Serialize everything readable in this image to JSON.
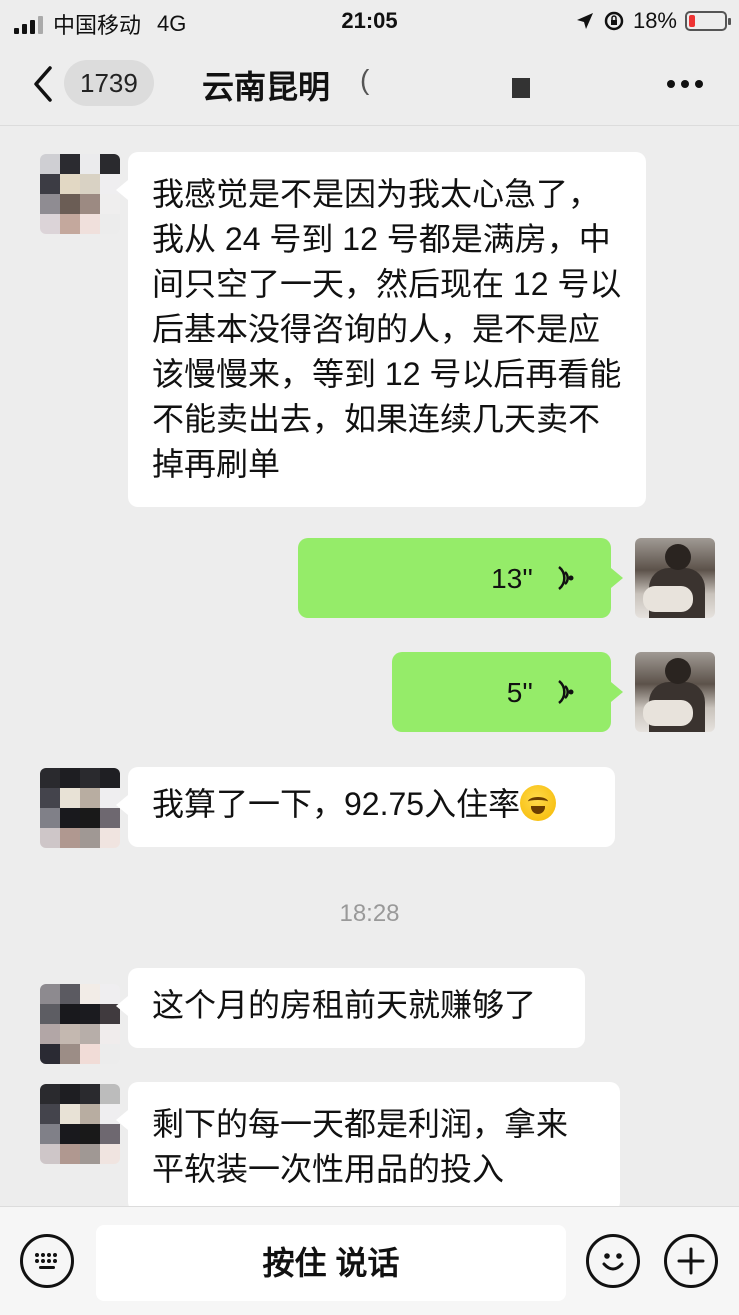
{
  "status_bar": {
    "carrier": "中国移动",
    "network": "4G",
    "time": "21:05",
    "battery_percent": "18%",
    "battery_level": 0.18
  },
  "header": {
    "unread_count": "1739",
    "title": "云南昆明",
    "title_suffix": "("
  },
  "messages": [
    {
      "side": "left",
      "type": "text",
      "text": "我感觉是不是因为我太心急了，我从 24 号到 12 号都是满房，中间只空了一天，然后现在 12 号以后基本没得咨询的人，是不是应该慢慢来，等到 12 号以后再看能不能卖出去，如果连续几天卖不掉再刷单"
    },
    {
      "side": "right",
      "type": "voice",
      "duration": "13''"
    },
    {
      "side": "right",
      "type": "voice",
      "duration": "5''"
    },
    {
      "side": "left",
      "type": "text",
      "text": "我算了一下，92.75入住率",
      "emoji": "sweat-smile-emoji"
    },
    {
      "type": "timestamp",
      "text": "18:28"
    },
    {
      "side": "left",
      "type": "text",
      "text": "这个月的房租前天就赚够了"
    },
    {
      "side": "left",
      "type": "text",
      "text": "剩下的每一天都是利润，拿来平软装一次性用品的投入"
    }
  ],
  "input_bar": {
    "hold_to_talk_label": "按住 说话"
  },
  "colors": {
    "background": "#ededed",
    "outgoing_bubble": "#95ec69",
    "incoming_bubble": "#ffffff",
    "battery_low": "#ee3333"
  }
}
